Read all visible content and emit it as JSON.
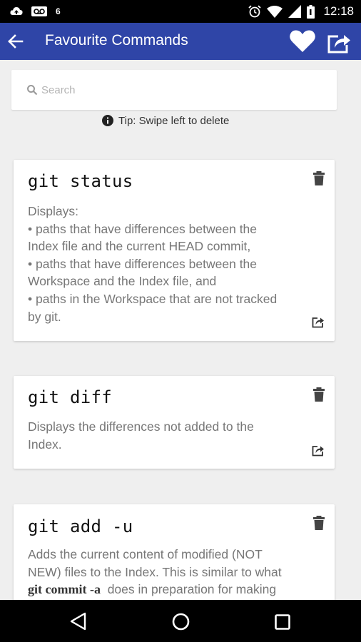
{
  "status_bar": {
    "time": "12:18",
    "left_icons": [
      "cloud-upload-icon",
      "voicemail-icon",
      "nfc-icon"
    ],
    "right_icons": [
      "alarm-icon",
      "wifi-icon",
      "signal-icon",
      "battery-icon"
    ],
    "nfc_text": "6"
  },
  "app_bar": {
    "title": "Favourite Commands",
    "color": "#2f45a7"
  },
  "search": {
    "placeholder": "Search",
    "value": ""
  },
  "tip": {
    "text": "Tip: Swipe left to delete"
  },
  "commands": [
    {
      "command": "git status",
      "description_lines": [
        "Displays:",
        "• paths that have differences between the",
        "Index file and the current HEAD commit,",
        "• paths that have differences between the",
        "Workspace and the Index file, and",
        "• paths in the Workspace that are not tracked",
        "by git."
      ]
    },
    {
      "command": "git diff",
      "description_lines": [
        "Displays the differences not added to the",
        "Index."
      ]
    },
    {
      "command": "git add -u",
      "description_lines": [
        "Adds the current content of modified (NOT",
        "NEW) files to the Index. This is similar to what"
      ],
      "description_code": "git commit -a",
      "description_after_code": "does in preparation for making"
    }
  ],
  "nav_bar": {
    "icons": [
      "nav-back-icon",
      "nav-home-icon",
      "nav-recents-icon"
    ]
  }
}
